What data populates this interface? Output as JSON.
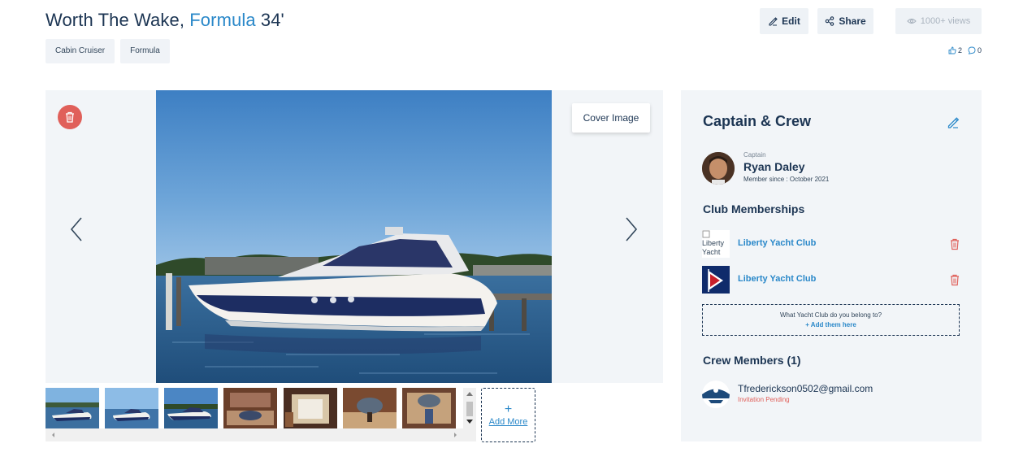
{
  "header": {
    "title_prefix": "Worth The Wake, ",
    "title_make": "Formula",
    "title_suffix": " 34'",
    "tags": [
      "Cabin Cruiser",
      "Formula"
    ],
    "edit_label": "Edit",
    "share_label": "Share",
    "views_label": "1000+ views",
    "likes": "2",
    "comments": "0"
  },
  "gallery": {
    "cover_label": "Cover Image",
    "add_more_plus": "+",
    "add_more_label": "Add More",
    "thumbnail_count": 7
  },
  "panel": {
    "title": "Captain & Crew",
    "captain": {
      "role": "Captain",
      "name": "Ryan Daley",
      "member_since": "Member since : October 2021"
    },
    "club_section_title": "Club Memberships",
    "clubs": [
      {
        "name": "Liberty Yacht Club",
        "logo_alt": "Liberty Yacht Club"
      },
      {
        "name": "Liberty Yacht Club",
        "logo_alt": ""
      }
    ],
    "club_prompt": "What Yacht Club do you belong to?",
    "club_prompt_link": "+ Add them here",
    "crew_section_title": "Crew Members (1)",
    "crew": [
      {
        "email": "Tfrederickson0502@gmail.com",
        "status": "Invitation Pending"
      }
    ]
  },
  "colors": {
    "accent": "#2a88c9",
    "text": "#1c3553",
    "danger": "#e0605a",
    "panel_bg": "#f2f5f8"
  }
}
